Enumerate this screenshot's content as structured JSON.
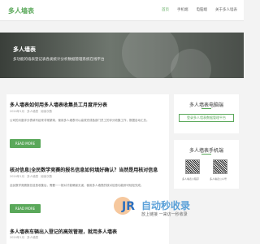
{
  "header": {
    "logo": "多人墙表",
    "nav": [
      "首页",
      "手机端",
      "电脑端",
      "关于多人墙表"
    ]
  },
  "banner": {
    "title": "多人墙表",
    "subtitle": "多功能的墙表登记表各类统计分析数据管理系统在线平台"
  },
  "posts": [
    {
      "title": "多人墙表如何用多人墙表收集员工月度评分表",
      "meta": [
        "2024年1月",
        "多人墙表",
        "阅读次数"
      ],
      "excerpt": "公司的月度评分表填写起来非常繁琐，使用多人墙表可以高效完成各部门员工的评分收集工作，数据自动汇总。",
      "readmore": "READ MORE"
    },
    {
      "title": "核对信息|全民数学竞赛的报名信息如何填好确认？当然是用核对信息",
      "meta": [
        "2024年1月",
        "多人墙表",
        "阅读次数"
      ],
      "excerpt": "全民数学竞赛报名信息收集后，需要一一核对才能确保无误，使用多人墙表的核对信息功能即可轻松完成。",
      "readmore": "READ MORE"
    },
    {
      "title": "多人墙表车辆出入登记的高效管理，就用多人墙表",
      "meta": [
        "2024年1月",
        "多人墙表"
      ],
      "excerpt": "",
      "readmore": ""
    }
  ],
  "sidebar": {
    "pc_title": "多人墙表电脑端",
    "pc_button": "登录多人墙表数据管理平台",
    "mobile_title": "多人墙表手机端",
    "qr_labels": [
      "多人墙表小程序",
      "多人墙表公众号"
    ]
  },
  "watermark": {
    "text": "自动秒收录",
    "sub": "放上链接 一来访一秒收录"
  }
}
